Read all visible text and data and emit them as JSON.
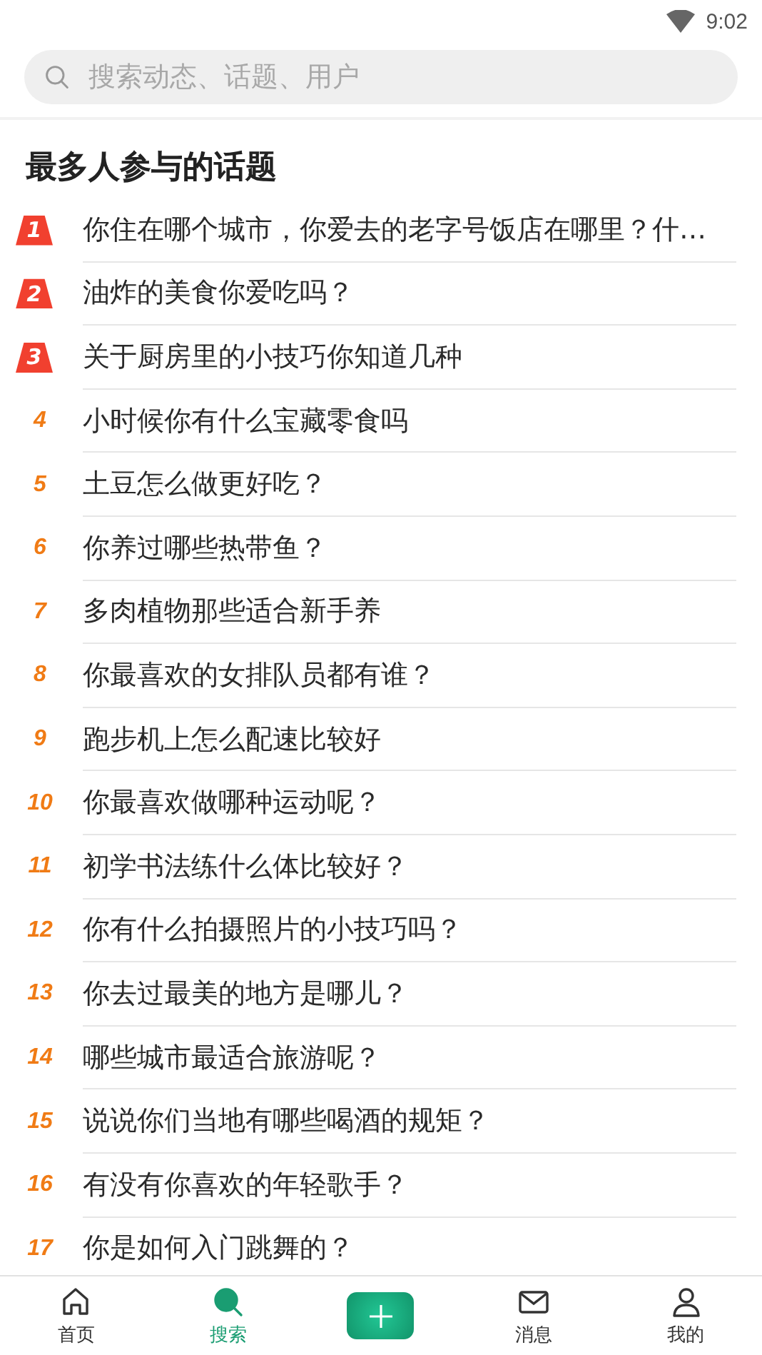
{
  "status_bar": {
    "time": "9:02"
  },
  "search": {
    "placeholder": "搜索动态、话题、用户"
  },
  "section": {
    "title": "最多人参与的话题"
  },
  "topics": [
    {
      "rank": "1",
      "kind": "badge",
      "title": "你住在哪个城市，你爱去的老字号饭店在哪里？什…"
    },
    {
      "rank": "2",
      "kind": "badge",
      "title": "油炸的美食你爱吃吗？"
    },
    {
      "rank": "3",
      "kind": "badge",
      "title": "关于厨房里的小技巧你知道几种"
    },
    {
      "rank": "4",
      "kind": "plain",
      "title": "小时候你有什么宝藏零食吗"
    },
    {
      "rank": "5",
      "kind": "plain",
      "title": "土豆怎么做更好吃？"
    },
    {
      "rank": "6",
      "kind": "plain",
      "title": "你养过哪些热带鱼？"
    },
    {
      "rank": "7",
      "kind": "plain",
      "title": "多肉植物那些适合新手养"
    },
    {
      "rank": "8",
      "kind": "plain",
      "title": "你最喜欢的女排队员都有谁？"
    },
    {
      "rank": "9",
      "kind": "plain",
      "title": "跑步机上怎么配速比较好"
    },
    {
      "rank": "10",
      "kind": "plain",
      "title": "你最喜欢做哪种运动呢？"
    },
    {
      "rank": "11",
      "kind": "plain",
      "title": "初学书法练什么体比较好？"
    },
    {
      "rank": "12",
      "kind": "plain",
      "title": "你有什么拍摄照片的小技巧吗？"
    },
    {
      "rank": "13",
      "kind": "plain",
      "title": "你去过最美的地方是哪儿？"
    },
    {
      "rank": "14",
      "kind": "plain",
      "title": "哪些城市最适合旅游呢？"
    },
    {
      "rank": "15",
      "kind": "plain",
      "title": "说说你们当地有哪些喝酒的规矩？"
    },
    {
      "rank": "16",
      "kind": "plain",
      "title": "有没有你喜欢的年轻歌手？"
    },
    {
      "rank": "17",
      "kind": "plain",
      "title": "你是如何入门跳舞的？"
    }
  ],
  "bottom_nav": [
    {
      "kind": "home",
      "label": "首页",
      "selected": false
    },
    {
      "kind": "search",
      "label": "搜索",
      "selected": true
    },
    {
      "kind": "add",
      "selected": false
    },
    {
      "kind": "mail",
      "label": "消息",
      "selected": false
    },
    {
      "kind": "user",
      "label": "我的",
      "selected": false
    }
  ]
}
